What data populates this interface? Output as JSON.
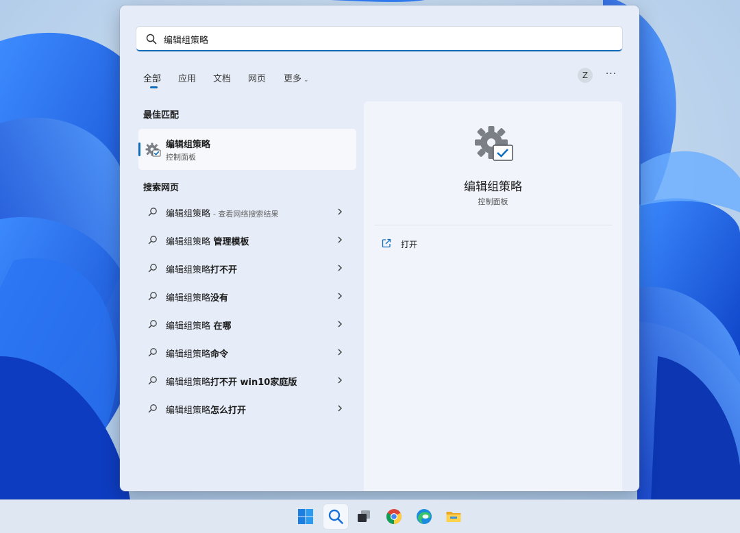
{
  "search": {
    "query": "编辑组策略",
    "icon": "search-icon"
  },
  "tabs": [
    {
      "label": "全部",
      "active": true
    },
    {
      "label": "应用"
    },
    {
      "label": "文档"
    },
    {
      "label": "网页"
    },
    {
      "label": "更多"
    }
  ],
  "header": {
    "avatar_letter": "Z",
    "more_label": "···"
  },
  "best_match": {
    "section_title": "最佳匹配",
    "name": "编辑组策略",
    "subtitle": "控制面板",
    "icon": "gear-check-icon"
  },
  "web_search": {
    "section_title": "搜索网页",
    "items": [
      {
        "prefix": "编辑组策略",
        "suffix": "",
        "hint": "- 查看网络搜索结果"
      },
      {
        "prefix": "编辑组策略",
        "suffix": " 管理模板",
        "hint": ""
      },
      {
        "prefix": "编辑组策略",
        "suffix": "打不开",
        "hint": ""
      },
      {
        "prefix": "编辑组策略",
        "suffix": "没有",
        "hint": ""
      },
      {
        "prefix": "编辑组策略",
        "suffix": " 在哪",
        "hint": ""
      },
      {
        "prefix": "编辑组策略",
        "suffix": "命令",
        "hint": ""
      },
      {
        "prefix": "编辑组策略",
        "suffix": "打不开 win10家庭版",
        "hint": ""
      },
      {
        "prefix": "编辑组策略",
        "suffix": "怎么打开",
        "hint": ""
      }
    ]
  },
  "detail": {
    "name": "编辑组策略",
    "subtitle": "控制面板",
    "action_label": "打开",
    "action_icon": "open-external-icon"
  },
  "taskbar": {
    "items": [
      "windows-start-icon",
      "search-icon",
      "task-view-icon",
      "chrome-icon",
      "edge-icon",
      "file-explorer-icon"
    ]
  },
  "colors": {
    "accent": "#0f6cbd",
    "panel_bg": "#e6edf8",
    "wallpaper_blue": "#1a5fe0"
  }
}
